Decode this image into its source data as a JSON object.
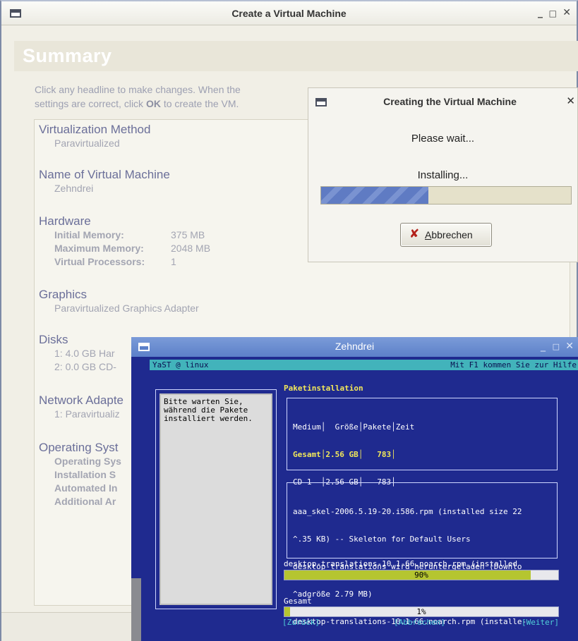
{
  "main_window": {
    "title": "Create a Virtual Machine",
    "controls": {
      "minimize": "_",
      "maximize": "□",
      "close": "✕"
    },
    "banner": "Summary",
    "instructions": {
      "line1": "Click any headline to make changes.  When the",
      "line2_pre": "settings are correct, click ",
      "line2_ok": "OK",
      "line2_post": " to create the VM."
    },
    "sections": {
      "virtualization": {
        "head": "Virtualization Method",
        "value": "Paravirtualized"
      },
      "name": {
        "head": "Name of Virtual Machine",
        "value": "Zehndrei"
      },
      "hardware": {
        "head": "Hardware",
        "rows": [
          {
            "k": "Initial Memory:",
            "v": "375 MB"
          },
          {
            "k": "Maximum Memory:",
            "v": "2048 MB"
          },
          {
            "k": "Virtual Processors:",
            "v": "1"
          }
        ]
      },
      "graphics": {
        "head": "Graphics",
        "value": "Paravirtualized Graphics Adapter"
      },
      "disks": {
        "head": "Disks",
        "items": [
          "1: 4.0 GB Har",
          "2: 0.0 GB CD-"
        ]
      },
      "network": {
        "head": "Network Adapte",
        "value": "1: Paravirtualiz"
      },
      "os": {
        "head": "Operating Syst",
        "items": [
          "Operating Sys",
          "Installation S",
          "Automated In",
          "Additional Ar"
        ]
      }
    }
  },
  "progress_dialog": {
    "title": "Creating the Virtual Machine",
    "close": "✕",
    "wait_text": "Please wait...",
    "status": "Installing...",
    "progress_fraction": 0.43,
    "cancel_icon": "✘",
    "cancel_pre": "",
    "cancel_mnemonic": "A",
    "cancel_post": "bbrechen"
  },
  "terminal_window": {
    "title": "Zehndrei",
    "controls": {
      "minimize": "_",
      "maximize": "□",
      "close": "✕"
    },
    "header_left": "YaST @ linux",
    "header_right": "Mit F1 kommen Sie zur Hilfe",
    "help_text": "Bitte warten Sie,\nwährend die Pakete\ninstalliert werden.",
    "section_title": "Paketinstallation",
    "table": {
      "header": "Medium│  Größe│Pakete│Zeit",
      "gesamt": "Gesamt│2.56 GB│   783│",
      "cd1": "CD 1  │2.56 GB│   783│"
    },
    "log_lines": [
      "aaa_skel-2006.5.19-20.i586.rpm (installed size 22",
      "^.35 KB) -- Skeleton for Default Users",
      "desktop-translations wird heruntergeladen (Downlo",
      "^adgröße 2.79 MB)",
      "desktop-translations-10.1-66.noarch.rpm (installe-"
    ],
    "current_package": "desktop-translations-10.1-66.noarch.rpm (installed",
    "package_progress": {
      "label": "90%",
      "fraction": 0.9
    },
    "total_label": "Gesamt",
    "total_progress": {
      "label": "1%",
      "fraction": 0.02
    },
    "buttons": {
      "back": "[Zurück]",
      "abort": "[Abbrechen]",
      "next": "[Weiter]"
    }
  }
}
